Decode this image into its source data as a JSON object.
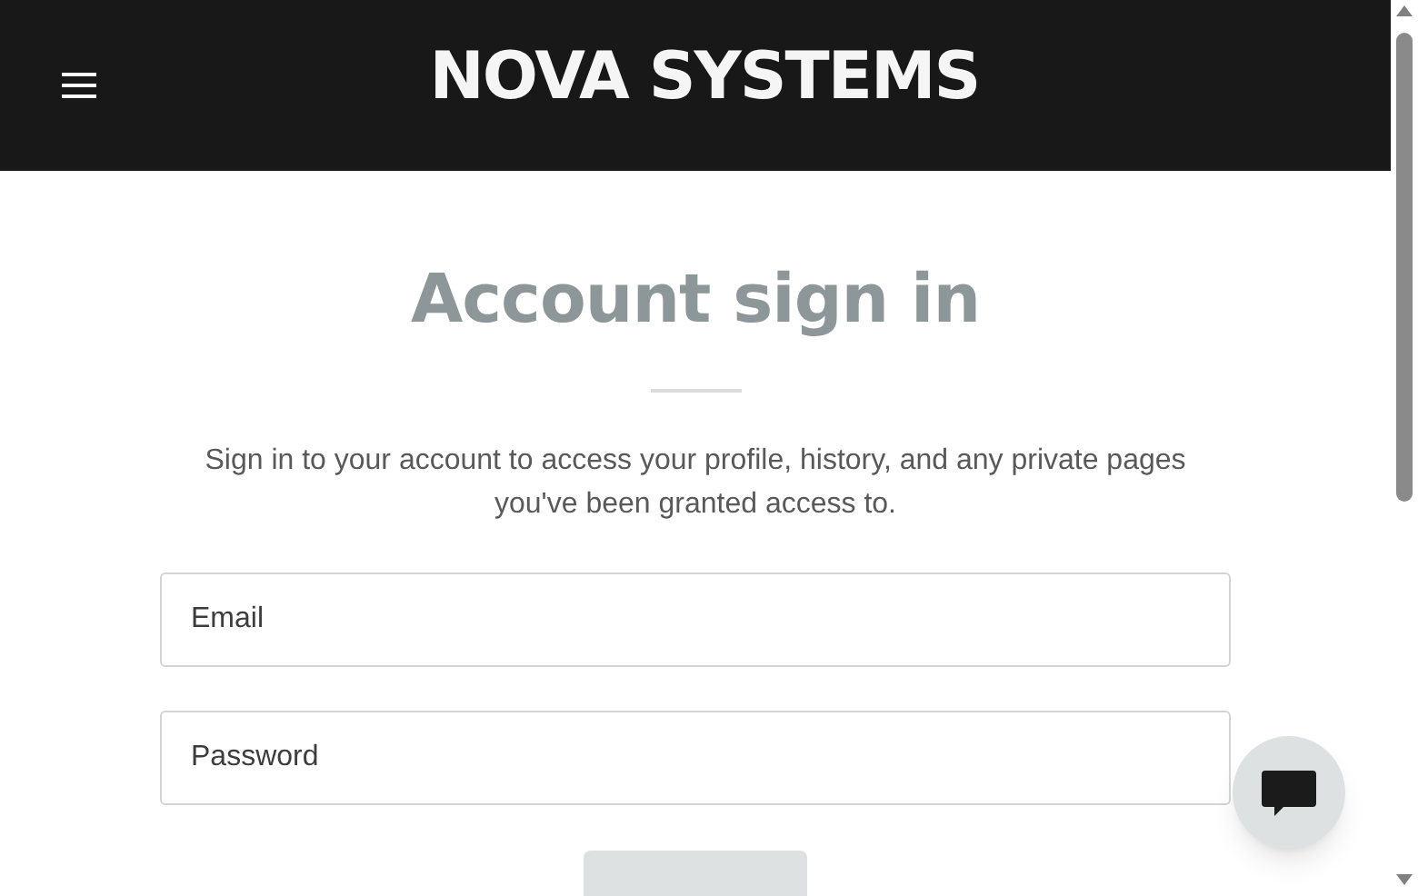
{
  "header": {
    "brand": "NOVA SYSTEMS"
  },
  "heading": "Account sign in",
  "description": "Sign in to your account to access your profile, history, and any private pages you've been granted access to.",
  "fields": [
    {
      "placeholder": "Email"
    },
    {
      "placeholder": "Password"
    }
  ]
}
